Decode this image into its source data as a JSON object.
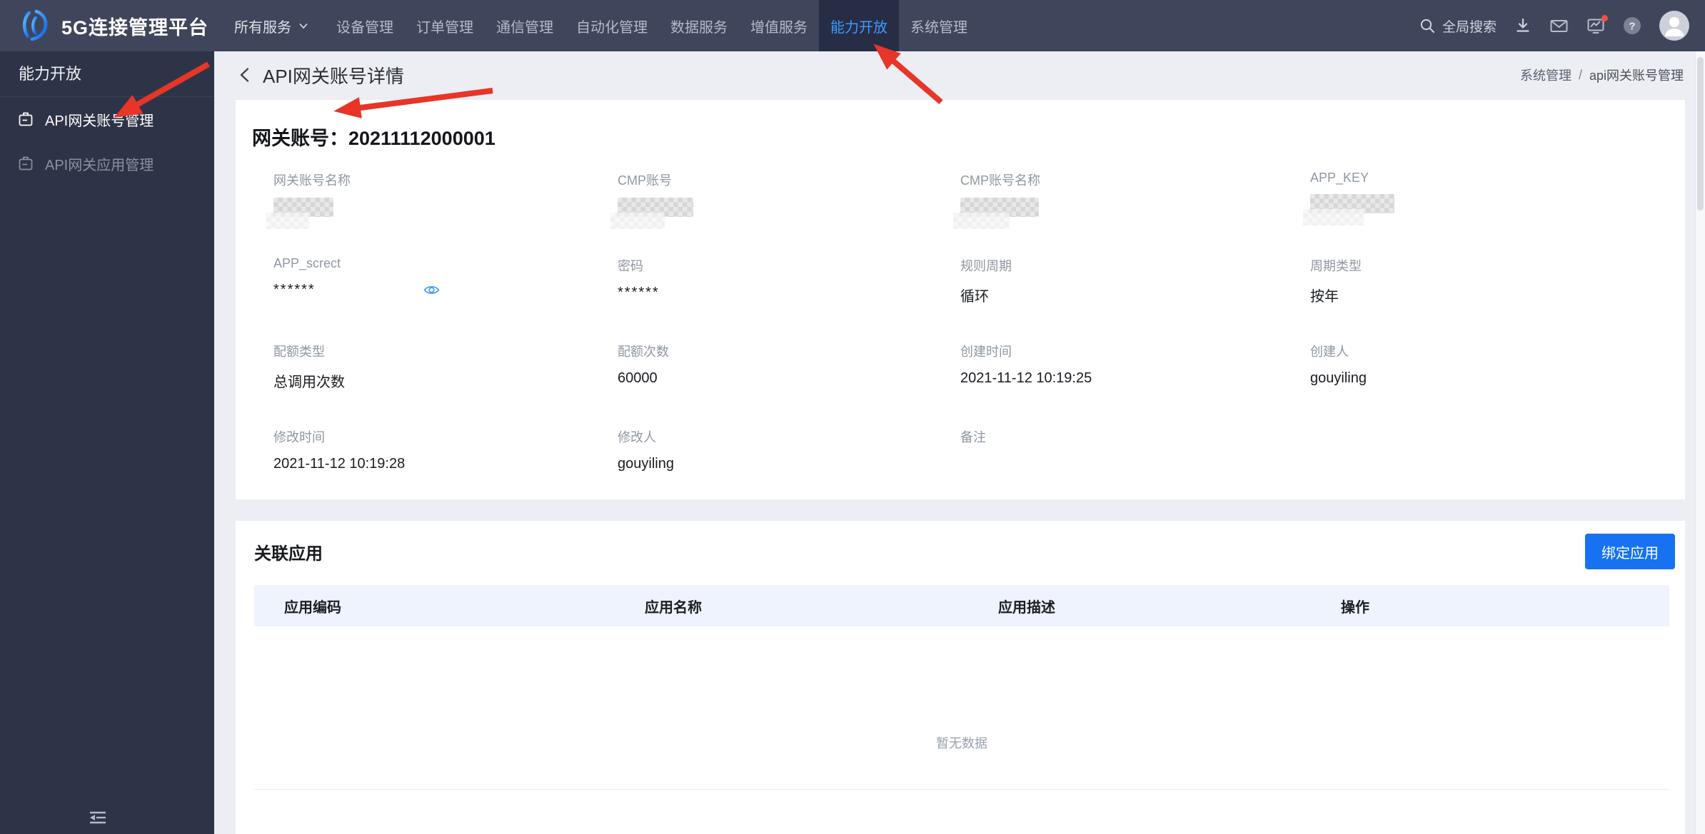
{
  "navbar": {
    "brand": "5G连接管理平台",
    "items": [
      "所有服务",
      "设备管理",
      "订单管理",
      "通信管理",
      "自动化管理",
      "数据服务",
      "增值服务",
      "能力开放",
      "系统管理"
    ],
    "active_item": "能力开放",
    "search": "全局搜索"
  },
  "sidebar": {
    "title": "能力开放",
    "items": [
      {
        "label": "API网关账号管理",
        "active": true
      },
      {
        "label": "API网关应用管理",
        "active": false
      }
    ]
  },
  "page": {
    "title": "API网关账号详情",
    "breadcrumb_1": "系统管理",
    "breadcrumb_sep": "/",
    "breadcrumb_2": "api网关账号管理"
  },
  "detail": {
    "heading_label": "网关账号：",
    "heading_value": "20211112000001",
    "fields": [
      {
        "label": "网关账号名称",
        "value": "",
        "redacted": true
      },
      {
        "label": "CMP账号",
        "value": "",
        "redacted": true
      },
      {
        "label": "CMP账号名称",
        "value": "",
        "redacted": true
      },
      {
        "label": "APP_KEY",
        "value": "",
        "redacted": true
      },
      {
        "label": "APP_screct",
        "value": "******",
        "masked": true
      },
      {
        "label": "密码",
        "value": "******",
        "masked": true
      },
      {
        "label": "规则周期",
        "value": "循环"
      },
      {
        "label": "周期类型",
        "value": "按年"
      },
      {
        "label": "配额类型",
        "value": "总调用次数"
      },
      {
        "label": "配额次数",
        "value": "60000"
      },
      {
        "label": "创建时间",
        "value": "2021-11-12 10:19:25"
      },
      {
        "label": "创建人",
        "value": "gouyiling"
      },
      {
        "label": "修改时间",
        "value": "2021-11-12 10:19:28"
      },
      {
        "label": "修改人",
        "value": "gouyiling"
      },
      {
        "label": "备注",
        "value": ""
      }
    ]
  },
  "related": {
    "title": "关联应用",
    "bind_button": "绑定应用",
    "columns": [
      "应用编码",
      "应用名称",
      "应用描述",
      "操作"
    ],
    "empty": "暂无数据"
  },
  "icons": {
    "brand-logo-icon": "stylized-phoenix",
    "dropdown-icon": "chevron-down",
    "search-icon": "magnifier",
    "download-icon": "arrow-down-tray",
    "mail-icon": "envelope",
    "monitor-icon": "screen-with-alert-dot",
    "help-icon": "question-circle",
    "avatar-icon": "person-circle",
    "sidebar-menu-icon": "clipboard",
    "fold-icon": "menu-fold",
    "back-icon": "chevron-left",
    "eye-icon": "eye"
  },
  "colors": {
    "navbar_bg": "#3f465c",
    "sidebar_bg": "#2e3447",
    "active_tab_bg": "#272d45",
    "active_tab_text": "#3d9aff",
    "accent_blue": "#1672f1",
    "table_header_bg": "#eef3fd",
    "page_bg": "#eceef4",
    "annotation_red": "#e73527"
  }
}
